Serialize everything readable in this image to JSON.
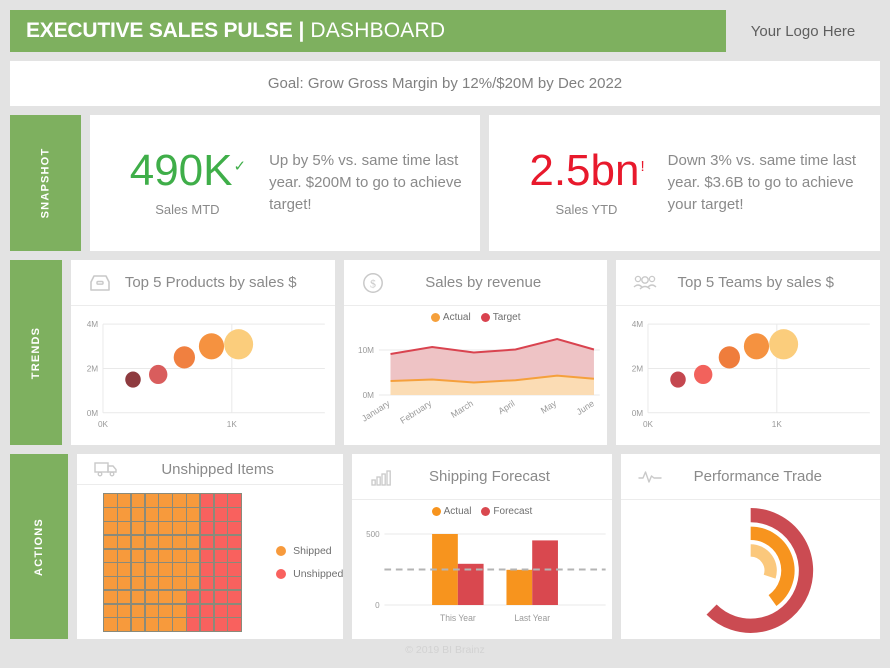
{
  "header": {
    "title_strong": "EXECUTIVE SALES PULSE",
    "title_separator": "|",
    "title_light": "DASHBOARD",
    "logo_placeholder": "Your Logo Here",
    "brand_green": "#7eb05f"
  },
  "goal": {
    "text": "Goal: Grow Gross Margin by 12%/$20M by Dec 2022"
  },
  "bands": {
    "snapshot_label": "SNAPSHOT",
    "trends_label": "TRENDS",
    "actions_label": "ACTIONS"
  },
  "kpis": [
    {
      "value": "490K",
      "flag": "✓",
      "caption": "Sales MTD",
      "commentary": "Up by 5% vs. same time last year. $200M to go to achieve target!",
      "color": "#3fae49",
      "direction": "up"
    },
    {
      "value": "2.5bn",
      "flag": "!",
      "caption": "Sales YTD",
      "commentary": "Down 3% vs. same time last year. $3.6B to go to achieve your target!",
      "color": "#e8192c",
      "direction": "down"
    }
  ],
  "cards": {
    "top_products": {
      "title": "Top 5 Products by sales $",
      "icon": "inbox-tray-icon"
    },
    "sales_revenue": {
      "title": "Sales by revenue",
      "icon": "dollar-circle-icon"
    },
    "top_teams": {
      "title": "Top 5 Teams by sales $",
      "icon": "people-group-icon"
    },
    "unshipped": {
      "title": "Unshipped Items",
      "icon": "truck-icon"
    },
    "shipping_forecast": {
      "title": "Shipping Forecast",
      "icon": "bar-chart-icon"
    },
    "performance": {
      "title": "Performance Trade",
      "icon": "pulse-wave-icon"
    }
  },
  "footer": {
    "text": "© 2019 BI Brainz"
  },
  "chart_data": [
    {
      "id": "top_products",
      "type": "scatter",
      "title": "Top 5 Products by sales $",
      "xlabel": "",
      "ylabel": "",
      "xlim": [
        0,
        1400
      ],
      "ylim": [
        0,
        4000000
      ],
      "xticks": [
        0,
        1000
      ],
      "xticklabels": [
        "0K",
        "1K"
      ],
      "yticks": [
        0,
        2000000,
        4000000
      ],
      "yticklabels": [
        "0M",
        "2M",
        "4M"
      ],
      "grid": true,
      "points": [
        {
          "x": 190,
          "y": 1500000,
          "r": 9,
          "color": "#8e3b3f"
        },
        {
          "x": 390,
          "y": 1750000,
          "r": 11,
          "color": "#d95d5d"
        },
        {
          "x": 620,
          "y": 2500000,
          "r": 14,
          "color": "#f08040"
        },
        {
          "x": 840,
          "y": 3000000,
          "r": 17,
          "color": "#f59240"
        },
        {
          "x": 1000,
          "y": 3100000,
          "r": 20,
          "color": "#fbcd7c"
        }
      ]
    },
    {
      "id": "sales_revenue",
      "type": "area",
      "title": "Sales by revenue",
      "xlabel": "",
      "ylabel": "",
      "categories": [
        "January",
        "February",
        "March",
        "April",
        "May",
        "June"
      ],
      "ylim": [
        0,
        14000000
      ],
      "yticks": [
        0,
        10000000
      ],
      "yticklabels": [
        "0M",
        "10M"
      ],
      "grid": true,
      "legend_position": "top",
      "series": [
        {
          "name": "Target",
          "color": "#d9434f",
          "fill": "#eec3c5",
          "values": [
            9200000,
            10700000,
            9600000,
            10200000,
            12500000,
            10200000
          ]
        },
        {
          "name": "Actual",
          "color": "#f5a03c",
          "fill": "#fbdcb4",
          "values": [
            3200000,
            3500000,
            2800000,
            3300000,
            4300000,
            3600000
          ]
        }
      ]
    },
    {
      "id": "top_teams",
      "type": "scatter",
      "title": "Top 5 Teams by sales $",
      "xlabel": "",
      "ylabel": "",
      "xlim": [
        0,
        1400
      ],
      "ylim": [
        0,
        4000000
      ],
      "xticks": [
        0,
        1000
      ],
      "xticklabels": [
        "0K",
        "1K"
      ],
      "yticks": [
        0,
        2000000,
        4000000
      ],
      "yticklabels": [
        "0M",
        "2M",
        "4M"
      ],
      "grid": true,
      "points": [
        {
          "x": 190,
          "y": 1500000,
          "r": 9,
          "color": "#c4474f"
        },
        {
          "x": 390,
          "y": 1750000,
          "r": 11,
          "color": "#f2625c"
        },
        {
          "x": 620,
          "y": 2500000,
          "r": 14,
          "color": "#ef7d3c"
        },
        {
          "x": 840,
          "y": 3000000,
          "r": 17,
          "color": "#f59240"
        },
        {
          "x": 1000,
          "y": 3100000,
          "r": 20,
          "color": "#fbcd7c"
        }
      ]
    },
    {
      "id": "unshipped",
      "type": "heatmap",
      "title": "Unshipped Items",
      "rows": 10,
      "columns": 10,
      "shipped_count": 67,
      "unshipped_count": 33,
      "legend": [
        {
          "name": "Shipped",
          "color": "#f79a3c"
        },
        {
          "name": "Unshipped",
          "color": "#f9615e"
        }
      ],
      "cells": [
        [
          1,
          1,
          1,
          1,
          1,
          1,
          1,
          0,
          0,
          0
        ],
        [
          1,
          1,
          1,
          1,
          1,
          1,
          1,
          0,
          0,
          0
        ],
        [
          1,
          1,
          1,
          1,
          1,
          1,
          1,
          0,
          0,
          0
        ],
        [
          1,
          1,
          1,
          1,
          1,
          1,
          1,
          0,
          0,
          0
        ],
        [
          1,
          1,
          1,
          1,
          1,
          1,
          1,
          0,
          0,
          0
        ],
        [
          1,
          1,
          1,
          1,
          1,
          1,
          1,
          0,
          0,
          0
        ],
        [
          1,
          1,
          1,
          1,
          1,
          1,
          1,
          0,
          0,
          0
        ],
        [
          1,
          1,
          1,
          1,
          1,
          1,
          0,
          0,
          0,
          0
        ],
        [
          1,
          1,
          1,
          1,
          1,
          1,
          0,
          0,
          0,
          0
        ],
        [
          1,
          1,
          1,
          1,
          1,
          1,
          0,
          0,
          0,
          0
        ]
      ]
    },
    {
      "id": "shipping_forecast",
      "type": "bar",
      "title": "Shipping Forecast",
      "categories": [
        "This Year",
        "Last Year"
      ],
      "ylim": [
        0,
        560
      ],
      "yticks": [
        0,
        500
      ],
      "yticklabels": [
        "0",
        "500"
      ],
      "grid": true,
      "legend_position": "top",
      "reference_line": 250,
      "series": [
        {
          "name": "Actual",
          "color": "#f7941e",
          "values": [
            500,
            248
          ]
        },
        {
          "name": "Forecast",
          "color": "#d9484f",
          "values": [
            290,
            455
          ]
        }
      ]
    },
    {
      "id": "performance",
      "type": "pie",
      "title": "Performance Trade",
      "rings": [
        {
          "name": "outer",
          "color": "#cb4b52",
          "percent": 78,
          "radius": 58,
          "thickness": 15
        },
        {
          "name": "middle",
          "color": "#f7941e",
          "percent": 40,
          "radius": 39,
          "thickness": 14
        },
        {
          "name": "inner",
          "color": "#fbc87c",
          "percent": 16,
          "radius": 21,
          "thickness": 13
        }
      ]
    }
  ]
}
